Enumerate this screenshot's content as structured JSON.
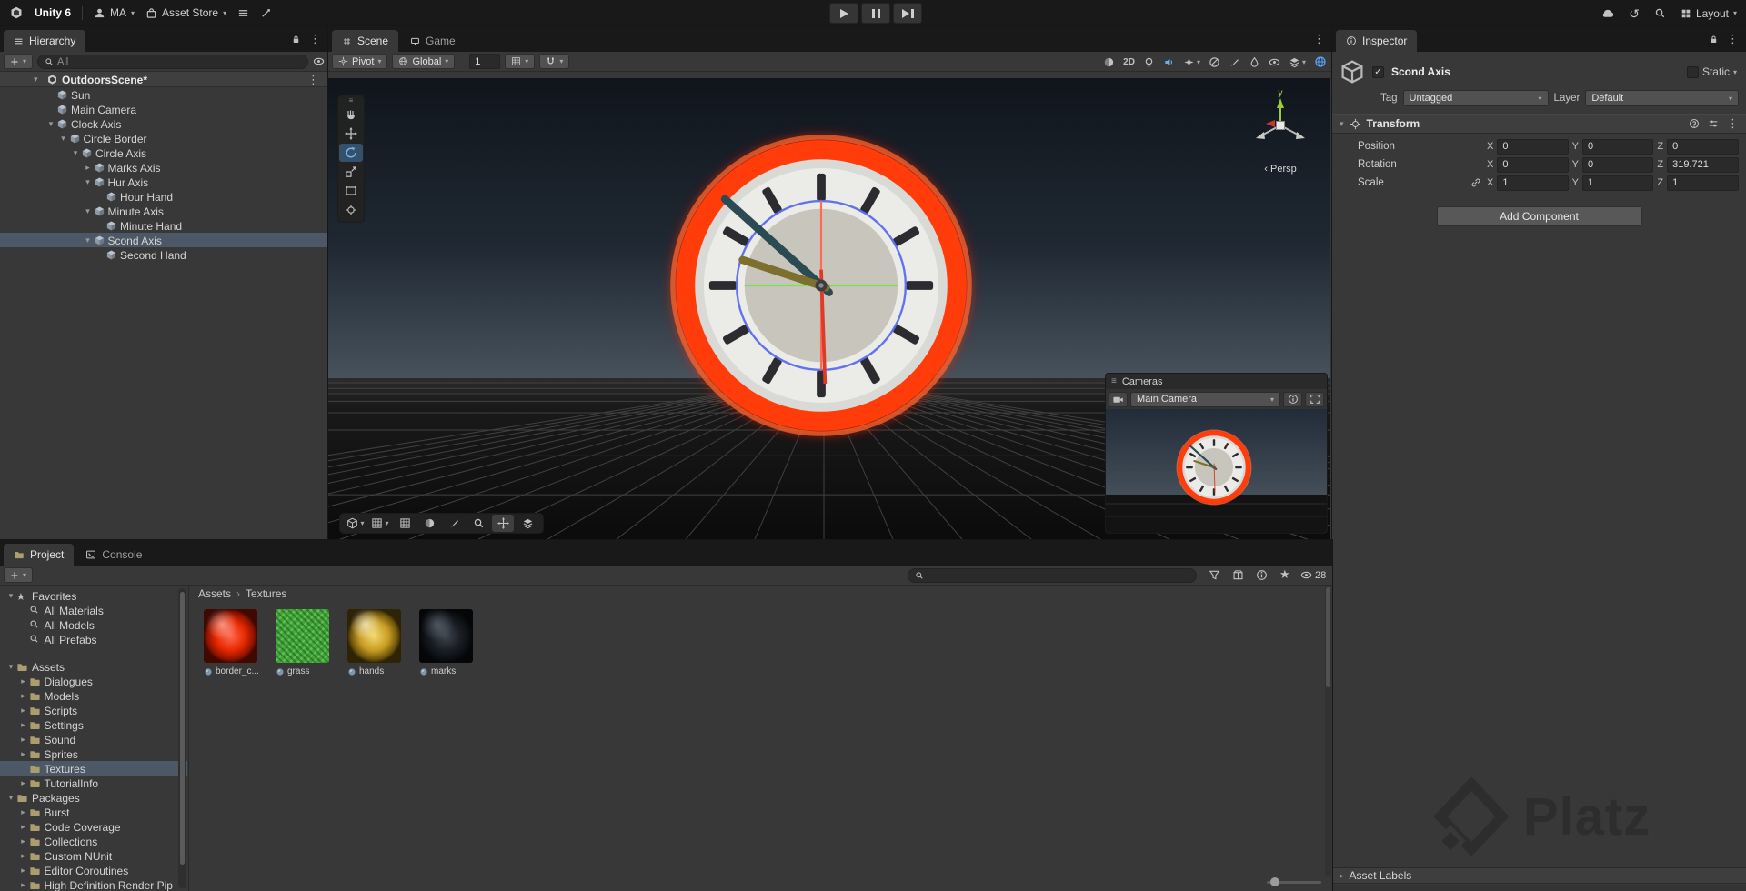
{
  "topbar": {
    "app": "Unity 6",
    "account": "MA",
    "asset_store": "Asset Store",
    "layout": "Layout"
  },
  "hierarchy": {
    "tab": "Hierarchy",
    "search_placeholder": "All",
    "scene_name": "OutdoorsScene*",
    "items": [
      {
        "label": "Sun",
        "level": 1,
        "arrow": null
      },
      {
        "label": "Main Camera",
        "level": 1,
        "arrow": null
      },
      {
        "label": "Clock Axis",
        "level": 1,
        "arrow": "open"
      },
      {
        "label": "Circle Border",
        "level": 2,
        "arrow": "open"
      },
      {
        "label": "Circle Axis",
        "level": 3,
        "arrow": "open"
      },
      {
        "label": "Marks Axis",
        "level": 4,
        "arrow": "closed"
      },
      {
        "label": "Hur Axis",
        "level": 4,
        "arrow": "open"
      },
      {
        "label": "Hour Hand",
        "level": 5,
        "arrow": null
      },
      {
        "label": "Minute Axis",
        "level": 4,
        "arrow": "open"
      },
      {
        "label": "Minute Hand",
        "level": 5,
        "arrow": null
      },
      {
        "label": "Scond Axis",
        "level": 4,
        "arrow": "open",
        "selected": true
      },
      {
        "label": "Second Hand",
        "level": 5,
        "arrow": null
      }
    ]
  },
  "scene": {
    "tab_scene": "Scene",
    "tab_game": "Game",
    "pivot": "Pivot",
    "handle_space": "Global",
    "grid_size": "1",
    "toolbar_2d": "2D",
    "persp": "Persp",
    "cameras": {
      "title": "Cameras",
      "selected": "Main Camera"
    }
  },
  "inspector": {
    "tab": "Inspector",
    "object_name": "Scond Axis",
    "static_label": "Static",
    "tag_label": "Tag",
    "tag_value": "Untagged",
    "layer_label": "Layer",
    "layer_value": "Default",
    "component": "Transform",
    "axis_labels": [
      "X",
      "Y",
      "Z"
    ],
    "transform_rows": [
      {
        "label": "Position",
        "x": "0",
        "y": "0",
        "z": "0",
        "link": false
      },
      {
        "label": "Rotation",
        "x": "0",
        "y": "0",
        "z": "319.721",
        "link": false
      },
      {
        "label": "Scale",
        "x": "1",
        "y": "1",
        "z": "1",
        "link": true
      }
    ],
    "add_component": "Add Component",
    "asset_labels": "Asset Labels"
  },
  "project": {
    "tab_project": "Project",
    "tab_console": "Console",
    "search_placeholder": "",
    "visible_count": "28",
    "breadcrumb": [
      "Assets",
      "Textures"
    ],
    "tree": [
      {
        "label": "Favorites",
        "level": 0,
        "arrow": "open",
        "icon": "star"
      },
      {
        "label": "All Materials",
        "level": 1,
        "arrow": null,
        "icon": "search"
      },
      {
        "label": "All Models",
        "level": 1,
        "arrow": null,
        "icon": "search"
      },
      {
        "label": "All Prefabs",
        "level": 1,
        "arrow": null,
        "icon": "search"
      },
      {
        "label": "Assets",
        "level": 0,
        "arrow": "open",
        "icon": "folder",
        "gap": true
      },
      {
        "label": "Dialogues",
        "level": 1,
        "arrow": "closed",
        "icon": "folder"
      },
      {
        "label": "Models",
        "level": 1,
        "arrow": "closed",
        "icon": "folder"
      },
      {
        "label": "Scripts",
        "level": 1,
        "arrow": "closed",
        "icon": "folder"
      },
      {
        "label": "Settings",
        "level": 1,
        "arrow": "closed",
        "icon": "folder"
      },
      {
        "label": "Sound",
        "level": 1,
        "arrow": "closed",
        "icon": "folder"
      },
      {
        "label": "Sprites",
        "level": 1,
        "arrow": "closed",
        "icon": "folder"
      },
      {
        "label": "Textures",
        "level": 1,
        "arrow": null,
        "icon": "folder",
        "selected": true
      },
      {
        "label": "TutorialInfo",
        "level": 1,
        "arrow": "closed",
        "icon": "folder"
      },
      {
        "label": "Packages",
        "level": 0,
        "arrow": "open",
        "icon": "folder"
      },
      {
        "label": "Burst",
        "level": 1,
        "arrow": "closed",
        "icon": "folder"
      },
      {
        "label": "Code Coverage",
        "level": 1,
        "arrow": "closed",
        "icon": "folder"
      },
      {
        "label": "Collections",
        "level": 1,
        "arrow": "closed",
        "icon": "folder"
      },
      {
        "label": "Custom NUnit",
        "level": 1,
        "arrow": "closed",
        "icon": "folder"
      },
      {
        "label": "Editor Coroutines",
        "level": 1,
        "arrow": "closed",
        "icon": "folder"
      },
      {
        "label": "High Definition Render Pip",
        "level": 1,
        "arrow": "closed",
        "icon": "folder"
      }
    ],
    "assets": [
      {
        "name": "border_c...",
        "kind": "sphere-red"
      },
      {
        "name": "grass",
        "kind": "texture-green"
      },
      {
        "name": "hands",
        "kind": "sphere-gold"
      },
      {
        "name": "marks",
        "kind": "sphere-dark"
      }
    ]
  },
  "watermark": "Platz",
  "colors": {
    "selection": "#4c5866",
    "accent_blue": "#6fb3f2",
    "clock_glow": "#ff2a00"
  },
  "icons": {
    "caret-down": "▾",
    "foldout-open": "▾",
    "foldout-closed": "▸",
    "menu-dots": "⋮",
    "breadcrumb-chevron": "›",
    "star": "★",
    "history": "↺",
    "grip": "≡",
    "check": "✓"
  }
}
